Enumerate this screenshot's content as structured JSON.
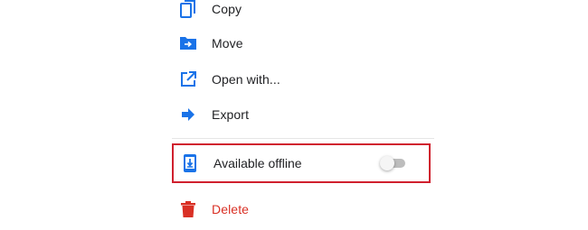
{
  "menu": {
    "copy": {
      "label": "Copy",
      "icon": "copy-icon"
    },
    "move": {
      "label": "Move",
      "icon": "folder-move-icon"
    },
    "open_with": {
      "label": "Open with...",
      "icon": "open-in-new-icon"
    },
    "export": {
      "label": "Export",
      "icon": "arrow-right-icon"
    },
    "available_offline": {
      "label": "Available offline",
      "icon": "offline-download-icon",
      "toggle_on": false
    },
    "delete": {
      "label": "Delete",
      "icon": "trash-icon"
    }
  },
  "colors": {
    "icon_blue": "#1a73e8",
    "delete_red": "#d93025",
    "highlight_border": "#d0202e",
    "text": "#202124"
  }
}
